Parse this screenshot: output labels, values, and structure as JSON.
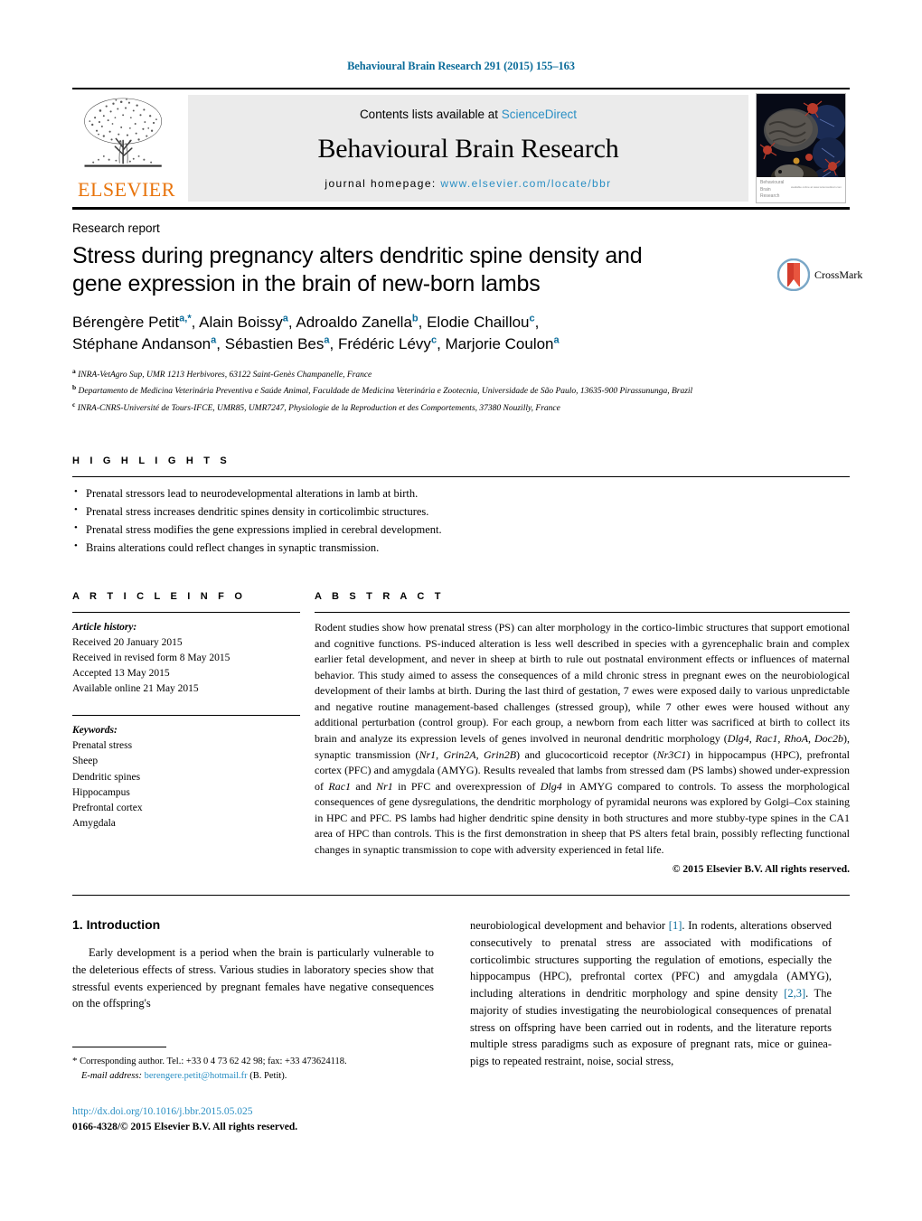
{
  "running_head": "Behavioural Brain Research 291 (2015) 155–163",
  "masthead": {
    "contents_prefix": "Contents lists available at ",
    "sciencedirect": "ScienceDirect",
    "journal_title": "Behavioural Brain Research",
    "homepage_prefix": "journal homepage: ",
    "homepage_url": "www.elsevier.com/locate/bbr",
    "publisher_wordmark": "ELSEVIER",
    "cover_caption_line1": "Behavioural",
    "cover_caption_line2": "Brain",
    "cover_caption_line3": "Research",
    "cover_caption_tiny": "available online at www.sciencedirect.com"
  },
  "article": {
    "type_label": "Research report",
    "title": "Stress during pregnancy alters dendritic spine density and gene expression in the brain of new-born lambs",
    "crossmark_label": "CrossMark",
    "authors_line1": [
      {
        "name": "Bérengère Petit",
        "sup": "a,*"
      },
      {
        "name": "Alain Boissy",
        "sup": "a"
      },
      {
        "name": "Adroaldo Zanella",
        "sup": "b"
      },
      {
        "name": "Elodie Chaillou",
        "sup": "c"
      }
    ],
    "authors_line2": [
      {
        "name": "Stéphane Andanson",
        "sup": "a"
      },
      {
        "name": "Sébastien Bes",
        "sup": "a"
      },
      {
        "name": "Frédéric Lévy",
        "sup": "c"
      },
      {
        "name": "Marjorie Coulon",
        "sup": "a"
      }
    ],
    "affiliations": [
      {
        "mark": "a",
        "text": "INRA-VetAgro Sup, UMR 1213 Herbivores, 63122 Saint-Genès Champanelle, France"
      },
      {
        "mark": "b",
        "text": "Departamento de Medicina Veterinária Preventiva e Saúde Animal, Faculdade de Medicina Veterinária e Zootecnia, Universidade de São Paulo, 13635-900 Pirassununga, Brazil"
      },
      {
        "mark": "c",
        "text": "INRA-CNRS-Université de Tours-IFCE, UMR85, UMR7247, Physiologie de la Reproduction et des Comportements, 37380 Nouzilly, France"
      }
    ]
  },
  "highlights": {
    "heading": "H I G H L I G H T S",
    "items": [
      "Prenatal stressors lead to neurodevelopmental alterations in lamb at birth.",
      "Prenatal stress increases dendritic spines density in corticolimbic structures.",
      "Prenatal stress modifies the gene expressions implied in cerebral development.",
      "Brains alterations could reflect changes in synaptic transmission."
    ]
  },
  "article_info": {
    "heading": "A R T I C L E    I N F O",
    "history_label": "Article history:",
    "history": [
      "Received 20 January 2015",
      "Received in revised form 8 May 2015",
      "Accepted 13 May 2015",
      "Available online 21 May 2015"
    ],
    "keywords_label": "Keywords:",
    "keywords": [
      "Prenatal stress",
      "Sheep",
      "Dendritic spines",
      "Hippocampus",
      "Prefrontal cortex",
      "Amygdala"
    ]
  },
  "abstract": {
    "heading": "A B S T R A C T",
    "paragraph_1": "Rodent studies show how prenatal stress (PS) can alter morphology in the cortico-limbic structures that support emotional and cognitive functions. PS-induced alteration is less well described in species with a gyrencephalic brain and complex earlier fetal development, and never in sheep at birth to rule out postnatal environment effects or influences of maternal behavior. This study aimed to assess the consequences of a mild chronic stress in pregnant ewes on the neurobiological development of their lambs at birth. During the last third of gestation, 7 ewes were exposed daily to various unpredictable and negative routine management-based challenges (stressed group), while 7 other ewes were housed without any additional perturbation (control group). For each group, a newborn from each litter was sacrificed at birth to collect its brain and analyze its expression levels of genes involved in neuronal dendritic morphology (",
    "genes_1": "Dlg4, Rac1, RhoA, Doc2b",
    "paragraph_2": "), synaptic transmission (",
    "genes_2": "Nr1, Grin2A, Grin2B",
    "paragraph_3": ") and glucocorticoid receptor (",
    "genes_3": "Nr3C1",
    "paragraph_4": ") in hippocampus (HPC), prefrontal cortex (PFC) and amygdala (AMYG). Results revealed that lambs from stressed dam (PS lambs) showed under-expression of ",
    "genes_4": "Rac1",
    "paragraph_5": " and ",
    "genes_5": "Nr1",
    "paragraph_6": " in PFC and overexpression of ",
    "genes_6": "Dlg4",
    "paragraph_7": " in AMYG compared to controls. To assess the morphological consequences of gene dysregulations, the dendritic morphology of pyramidal neurons was explored by Golgi–Cox staining in HPC and PFC. PS lambs had higher dendritic spine density in both structures and more stubby-type spines in the CA1 area of HPC than controls. This is the first demonstration in sheep that PS alters fetal brain, possibly reflecting functional changes in synaptic transmission to cope with adversity experienced in fetal life.",
    "copyright": "© 2015 Elsevier B.V. All rights reserved."
  },
  "introduction": {
    "heading": "1.  Introduction",
    "left_paragraph": "Early development is a period when the brain is particularly vulnerable to the deleterious effects of stress. Various studies in laboratory species show that stressful events experienced by pregnant females have negative consequences on the offspring's",
    "right_part_1": "neurobiological development and behavior ",
    "right_ref_1": "[1]",
    "right_part_2": ". In rodents, alterations observed consecutively to prenatal stress are associated with modifications of corticolimbic structures supporting the regulation of emotions, especially the hippocampus (HPC), prefrontal cortex (PFC) and amygdala (AMYG), including alterations in dendritic morphology and spine density ",
    "right_ref_2": "[2,3]",
    "right_part_3": ". The majority of studies investigating the neurobiological consequences of prenatal stress on offspring have been carried out in rodents, and the literature reports multiple stress paradigms such as exposure of pregnant rats, mice or guinea-pigs to repeated restraint, noise, social stress,"
  },
  "footer": {
    "corresponding_star": "*",
    "corresponding_text": "Corresponding author. Tel.: +33 0 4 73 62 42 98; fax: +33 473624118.",
    "email_label": "E-mail address:",
    "email": "berengere.petit@hotmail.fr",
    "email_owner": "(B. Petit).",
    "doi": "http://dx.doi.org/10.1016/j.bbr.2015.05.025",
    "issn_line": "0166-4328/© 2015 Elsevier B.V. All rights reserved."
  },
  "colors": {
    "link": "#2a8fc4",
    "running_head": "#0b6c9a",
    "elsevier_orange": "#E8740C",
    "masthead_bg": "#ebebeb"
  }
}
